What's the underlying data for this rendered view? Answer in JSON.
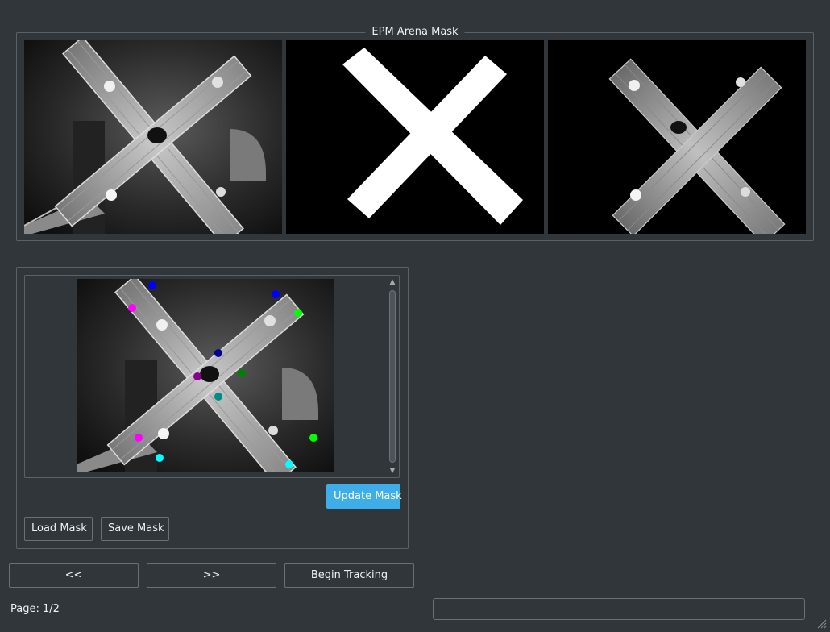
{
  "mask_group": {
    "title": "EPM Arena Mask",
    "panels": [
      "original-frame",
      "binary-mask",
      "masked-frame"
    ]
  },
  "editor": {
    "points": [
      {
        "color": "#0000ff"
      },
      {
        "color": "#ff00ff"
      },
      {
        "color": "#0000ff"
      },
      {
        "color": "#00ff00"
      },
      {
        "color": "#00008b"
      },
      {
        "color": "#8b008b"
      },
      {
        "color": "#008000"
      },
      {
        "color": "#008b8b"
      },
      {
        "color": "#ff00ff"
      },
      {
        "color": "#00ffff"
      },
      {
        "color": "#00ff00"
      },
      {
        "color": "#00ffff"
      }
    ],
    "update_label": "Update Mask",
    "load_label": "Load Mask",
    "save_label": "Save Mask"
  },
  "nav": {
    "prev_label": "<<",
    "next_label": ">>",
    "begin_label": "Begin Tracking"
  },
  "status": {
    "page_text": "Page: 1/2",
    "message": ""
  },
  "colors": {
    "background": "#31363b",
    "accent": "#3daee9",
    "border": "#5c6167"
  },
  "icons": {
    "scroll_up": "triangle-up-icon",
    "scroll_down": "triangle-down-icon",
    "resize": "size-grip-icon"
  }
}
